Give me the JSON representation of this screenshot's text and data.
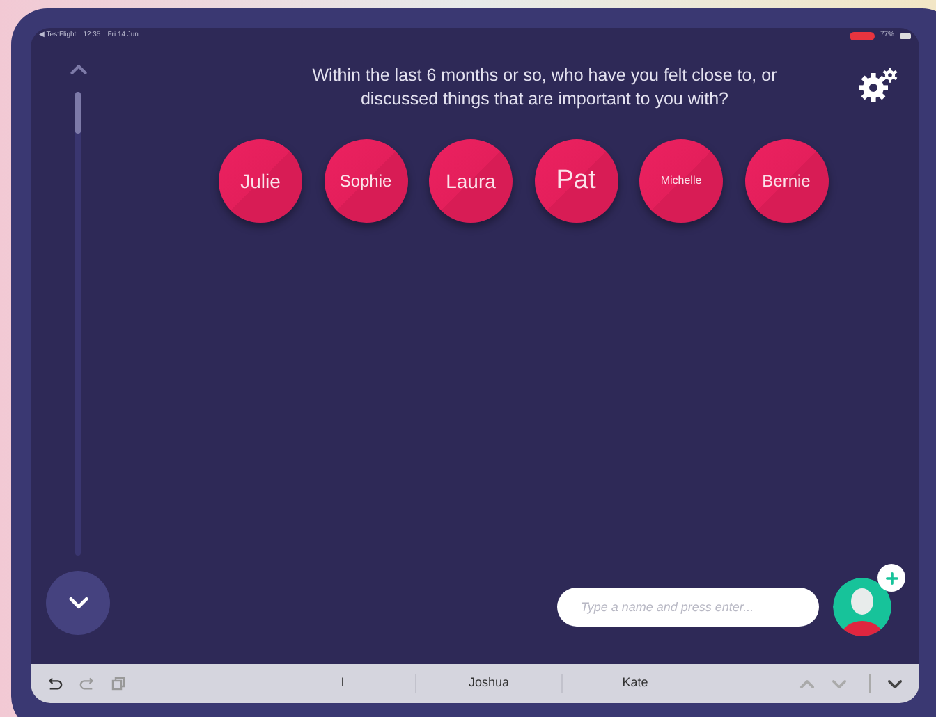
{
  "status_bar": {
    "back_app": "◀ TestFlight",
    "time": "12:35",
    "date": "Fri 14 Jun",
    "battery": "77%"
  },
  "question": "Within the last 6 months or so, who have you felt close to, or discussed things that are important to you with?",
  "people": [
    {
      "name": "Julie",
      "kind": "medium"
    },
    {
      "name": "Sophie",
      "kind": "normal"
    },
    {
      "name": "Laura",
      "kind": "medium"
    },
    {
      "name": "Pat",
      "kind": "large"
    },
    {
      "name": "Michelle",
      "kind": "small"
    },
    {
      "name": "Bernie",
      "kind": "normal"
    }
  ],
  "name_input": {
    "placeholder": "Type a name and press enter..."
  },
  "keyboard_bar": {
    "suggestions": [
      "I",
      "Joshua",
      "Kate"
    ]
  }
}
